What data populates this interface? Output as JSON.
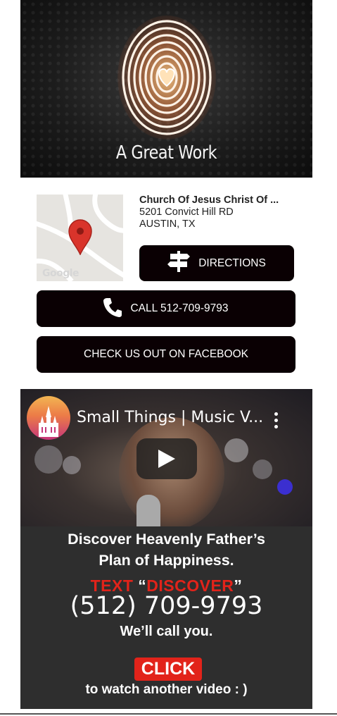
{
  "hero": {
    "title": "A Great Work",
    "graphic": "glowing-fingerprint-heart"
  },
  "location": {
    "map_attribution": "Google",
    "name": "Church Of Jesus Christ Of ...",
    "address_line1": "5201 Convict Hill RD",
    "address_line2": "AUSTIN, TX"
  },
  "buttons": {
    "directions_label": "DIRECTIONS",
    "directions_icon": "signpost-icon",
    "call_label": "CALL 512-709-9793",
    "call_icon": "phone-icon",
    "facebook_label": "CHECK US OUT ON FACEBOOK"
  },
  "video": {
    "title": "Small Things | Music V...",
    "promo_line1": "Discover Heavenly Father’s",
    "promo_line2": "Plan of Happiness.",
    "promo_text_word": "TEXT",
    "promo_quote_open": "“",
    "promo_keyword": "DISCOVER",
    "promo_quote_close": "”",
    "promo_phone": "(512) 709-9793",
    "promo_call": "We’ll call you.",
    "click_label": "CLICK",
    "promo_another": "to watch another video : )"
  },
  "colors": {
    "button_bg": "#0a0003",
    "accent_red": "#e2231a",
    "map_pin": "#d9342b"
  }
}
